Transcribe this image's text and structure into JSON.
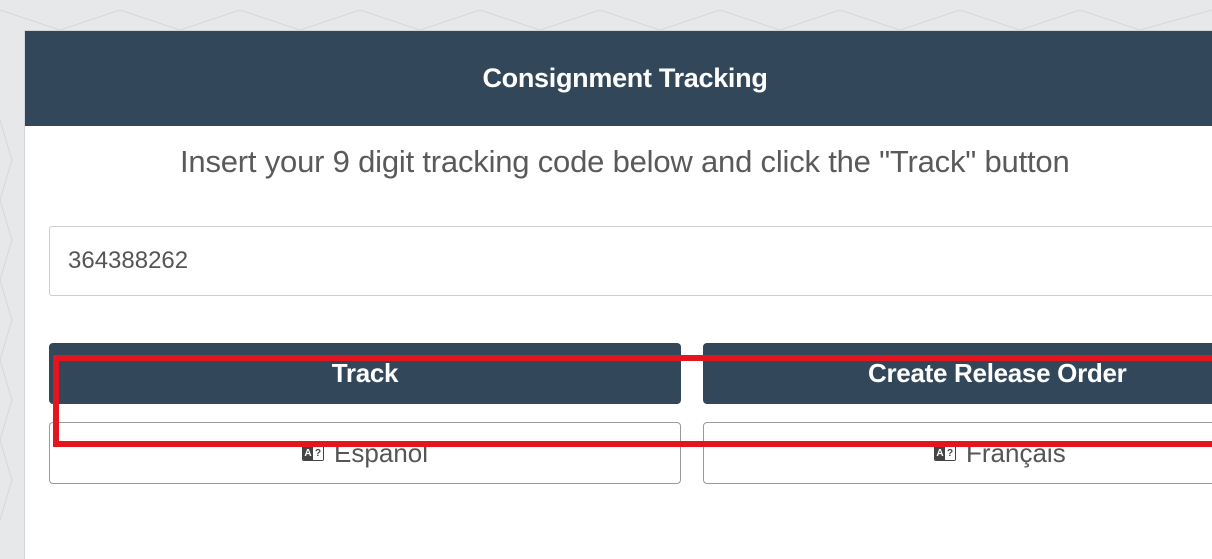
{
  "page": {
    "header_title": "Consignment Tracking",
    "instruction": "Insert your 9 digit tracking code below and click the \"Track\" button",
    "tracking_value": "364388262"
  },
  "buttons": {
    "track_label": "Track",
    "release_label": "Create Release Order",
    "spanish_label": "Español",
    "french_label": "Français"
  },
  "icons": {
    "spanish_icon": "language-icon",
    "french_icon": "language-icon"
  },
  "colors": {
    "header_bg": "#33475b",
    "primary_button": "#33475b",
    "highlight": "#e3161f",
    "page_bg": "#e6e8ea"
  }
}
